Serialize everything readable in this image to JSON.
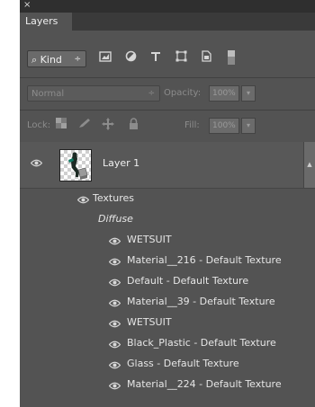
{
  "window": {
    "close_glyph": "×"
  },
  "tabs": [
    {
      "label": "Layers"
    }
  ],
  "filter": {
    "kind_label": "Kind",
    "kind_arrow": "÷"
  },
  "blend": {
    "mode": "Normal",
    "arrow": "÷",
    "opacity_label": "Opacity:",
    "opacity_value": "100%",
    "opacity_arrow": "▾"
  },
  "lock": {
    "label": "Lock:",
    "fill_label": "Fill:",
    "fill_value": "100%",
    "fill_arrow": "▾"
  },
  "layers": [
    {
      "name": "Layer 1",
      "effects_label": "Textures",
      "group_label": "Diffuse",
      "textures": [
        "WETSUIT",
        "Material__216 - Default Texture",
        "Default - Default Texture",
        "Material__39 - Default Texture",
        "WETSUIT",
        "Black_Plastic - Default Texture",
        "Glass - Default Texture",
        "Material__224 - Default Texture"
      ]
    }
  ],
  "colors": {
    "panel_bg": "#535353",
    "titlebar_bg": "#2f2f2f",
    "text": "#e6e6e6",
    "disabled_text": "#8c8c8c"
  }
}
